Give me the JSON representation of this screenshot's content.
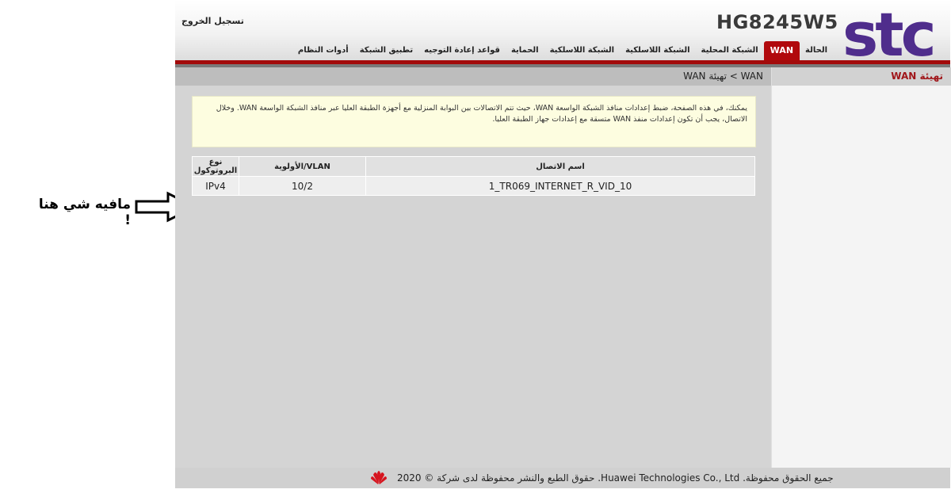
{
  "annotation": {
    "text": "مافيه شي هنا !"
  },
  "header": {
    "logout_label": "تسجيل الخروج",
    "model": "HG8245W5",
    "brand": "stc",
    "brand_color": "#4f2d8c"
  },
  "nav": {
    "items": [
      {
        "label": "الحالة"
      },
      {
        "label": "WAN"
      },
      {
        "label": "الشبكة المحلية"
      },
      {
        "label": "الشبكة اللاسلكية"
      },
      {
        "label": "الشبكة اللاسلكية"
      },
      {
        "label": "الحماية"
      },
      {
        "label": "قواعد إعادة التوجيه"
      },
      {
        "label": "تطبيق الشبكة"
      },
      {
        "label": "أدوات النظام"
      }
    ],
    "active_index": 1,
    "accent_color": "#b1090c"
  },
  "sidebar": {
    "heading": "تهيئة WAN"
  },
  "breadcrumb": "WAN > تهيئة WAN",
  "info_text": "يمكنك، في هذه الصفحة، ضبط إعدادات منافذ الشبكة الواسعة WAN، حيث تتم الاتصالات بين البوابة المنزلية مع أجهزة الطبقة العليا عبر منافذ الشبكة الواسعة WAN. وخلال الاتصال، يجب أن تكون إعدادات منفذ WAN متسقة مع إعدادات جهاز الطبقة العليا.",
  "table": {
    "headers": [
      "اسم الاتصال",
      "VLAN/الأولوية",
      "نوع البروتوكول"
    ],
    "rows": [
      {
        "connection": "1_TR069_INTERNET_R_VID_10",
        "vlan": "10/2",
        "protocol": "IPv4"
      }
    ]
  },
  "footer": {
    "text": "جميع الحقوق محفوظة. Huawei Technologies Co., Ltd. حقوق الطبع والنشر محفوظة لدى شركة © 2020"
  }
}
